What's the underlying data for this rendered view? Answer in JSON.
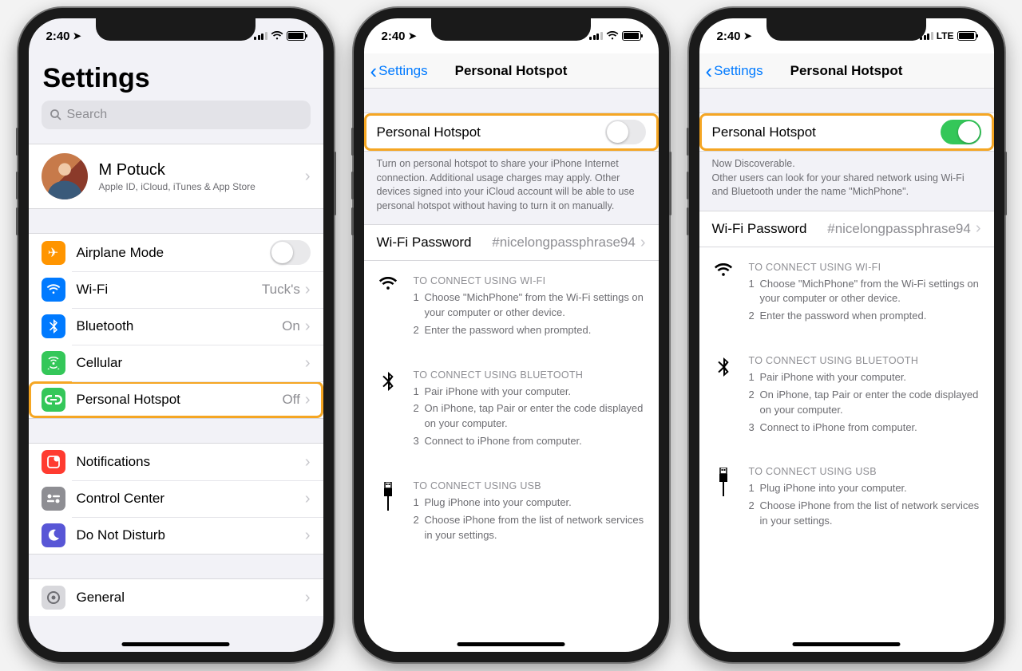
{
  "status": {
    "time": "2:40",
    "network_lte": "LTE"
  },
  "screen1": {
    "title": "Settings",
    "search_placeholder": "Search",
    "profile": {
      "name": "M Potuck",
      "sub": "Apple ID, iCloud, iTunes & App Store"
    },
    "airplane": "Airplane Mode",
    "wifi": {
      "label": "Wi-Fi",
      "value": "Tuck's"
    },
    "bluetooth": {
      "label": "Bluetooth",
      "value": "On"
    },
    "cellular": "Cellular",
    "hotspot": {
      "label": "Personal Hotspot",
      "value": "Off"
    },
    "notifications": "Notifications",
    "control_center": "Control Center",
    "dnd": "Do Not Disturb",
    "general": "General"
  },
  "screen2": {
    "back": "Settings",
    "title": "Personal Hotspot",
    "toggle_label": "Personal Hotspot",
    "toggle_on": false,
    "footnote": "Turn on personal hotspot to share your iPhone Internet connection. Additional usage charges may apply. Other devices signed into your iCloud account will be able to use personal hotspot without having to turn it on manually.",
    "wifi_pw_label": "Wi-Fi Password",
    "wifi_pw_value": "#nicelongpassphrase94"
  },
  "screen3": {
    "back": "Settings",
    "title": "Personal Hotspot",
    "toggle_label": "Personal Hotspot",
    "toggle_on": true,
    "discoverable": "Now Discoverable.",
    "discoverable_sub": "Other users can look for your shared network using Wi-Fi and Bluetooth under the name \"MichPhone\".",
    "wifi_pw_label": "Wi-Fi Password",
    "wifi_pw_value": "#nicelongpassphrase94"
  },
  "connect": {
    "wifi_title": "TO CONNECT USING WI-FI",
    "wifi_steps": [
      "Choose \"MichPhone\" from the Wi-Fi settings on your computer or other device.",
      "Enter the password when prompted."
    ],
    "bt_title": "TO CONNECT USING BLUETOOTH",
    "bt_steps": [
      "Pair iPhone with your computer.",
      "On iPhone, tap Pair or enter the code displayed on your computer.",
      "Connect to iPhone from computer."
    ],
    "usb_title": "TO CONNECT USING USB",
    "usb_steps": [
      "Plug iPhone into your computer.",
      "Choose iPhone from the list of network services in your settings."
    ]
  },
  "icons": {
    "airplane_bg": "#ff9500",
    "wifi_bg": "#007aff",
    "bt_bg": "#007aff",
    "cell_bg": "#34c759",
    "hotspot_bg": "#34c759",
    "notif_bg": "#ff3b30",
    "cc_bg": "#8e8e93",
    "dnd_bg": "#5856d6"
  }
}
